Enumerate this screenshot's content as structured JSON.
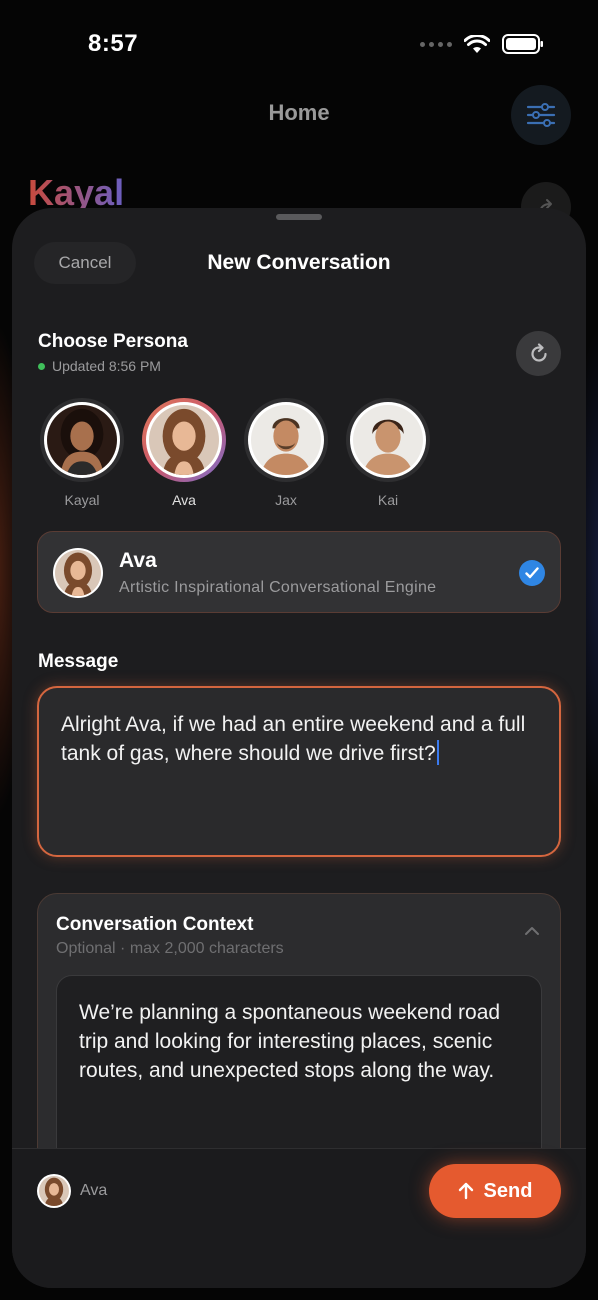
{
  "status_bar": {
    "time": "8:57"
  },
  "home": {
    "title": "Home",
    "brand": "Kayal"
  },
  "sheet": {
    "cancel_label": "Cancel",
    "title": "New Conversation"
  },
  "persona_section": {
    "label": "Choose Persona",
    "updated": "Updated 8:56 PM"
  },
  "personas": [
    {
      "name": "Kayal",
      "selected": false
    },
    {
      "name": "Ava",
      "selected": true
    },
    {
      "name": "Jax",
      "selected": false
    },
    {
      "name": "Kai",
      "selected": false
    }
  ],
  "selected_persona": {
    "name": "Ava",
    "description": "Artistic Inspirational Conversational Engine"
  },
  "message": {
    "label": "Message",
    "text": "Alright Ava, if we had an entire weekend and a full tank of gas, where should we drive first?"
  },
  "context": {
    "title": "Conversation Context",
    "subtitle": "Optional · max 2,000 characters",
    "text": "We’re planning a spontaneous weekend road trip and looking for interesting places, scenic routes, and unexpected stops along the way."
  },
  "footer": {
    "persona_name": "Ava",
    "send_label": "Send"
  },
  "colors": {
    "accent": "#e55a2f",
    "check": "#2f86e4",
    "online": "#3fbf5a"
  }
}
